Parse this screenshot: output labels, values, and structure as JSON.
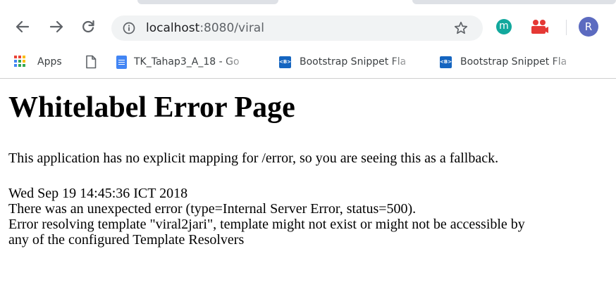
{
  "toolbar": {
    "back_icon": "arrow-left-icon",
    "forward_icon": "arrow-right-icon",
    "reload_icon": "reload-icon",
    "address": {
      "host": "localhost",
      "rest": ":8080/viral"
    },
    "bookmark_star_icon": "star-outline-icon",
    "extension_m_label": "m",
    "extension_m_color": "#12a89d",
    "extension_people_color": "#e53935",
    "profile_initial": "R",
    "profile_color": "#5c6bc0"
  },
  "bookmarks": {
    "apps_label": "Apps",
    "items": [
      {
        "icon": "page-icon",
        "label": ""
      },
      {
        "icon": "google-docs-icon",
        "label": "TK_Tahap3_A_18 - Go"
      },
      {
        "icon": "bootstrap-icon",
        "label": "Bootstrap Snippet Fla"
      },
      {
        "icon": "bootstrap-icon",
        "label": "Bootstrap Snippet Fla"
      }
    ]
  },
  "page": {
    "title": "Whitelabel Error Page",
    "intro": "This application has no explicit mapping for /error, so you are seeing this as a fallback.",
    "timestamp": "Wed Sep 19 14:45:36 ICT 2018",
    "error_line": "There was an unexpected error (type=Internal Server Error, status=500).",
    "message_line1": "Error resolving template \"viral2jari\", template might not exist or might not be accessible by",
    "message_line2": "any of the configured Template Resolvers"
  }
}
